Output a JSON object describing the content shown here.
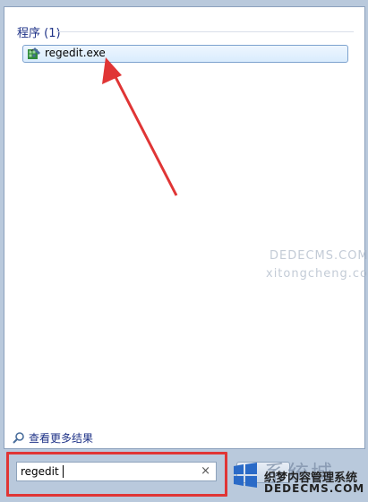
{
  "results_section": {
    "header": "程序 (1)",
    "items": [
      {
        "label": "regedit.exe",
        "icon": "regedit-icon"
      }
    ]
  },
  "see_more": {
    "label": "查看更多结果",
    "icon": "search-icon"
  },
  "search": {
    "value": "regedit",
    "clear_glyph": "×"
  },
  "watermark": {
    "site_name": "系统城",
    "cms_name": "织梦内容管理系统",
    "cms_url": "DEDECMS.COM",
    "ghost_text_1": "DEDECMS.COM",
    "ghost_text_2": "xitongcheng.com"
  },
  "colors": {
    "accent_red": "#e03535",
    "header_blue": "#1e3287"
  }
}
